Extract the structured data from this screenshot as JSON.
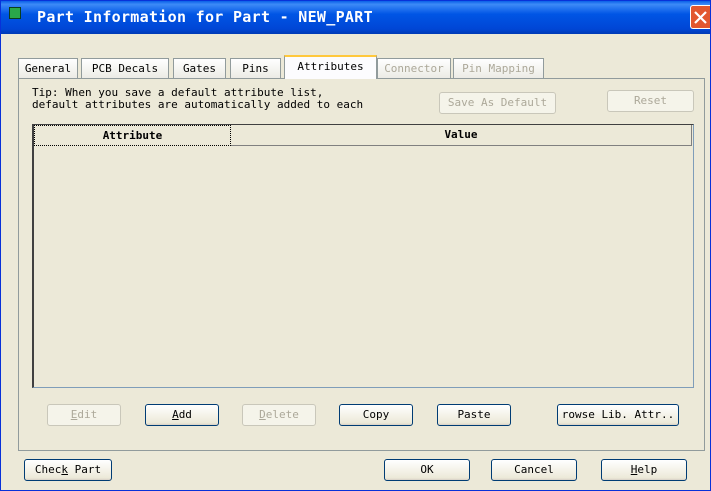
{
  "window": {
    "title": "Part Information for Part - NEW_PART"
  },
  "tabs": [
    {
      "label": "General",
      "state": "normal"
    },
    {
      "label": "PCB Decals",
      "state": "normal"
    },
    {
      "label": "Gates",
      "state": "normal"
    },
    {
      "label": "Pins",
      "state": "normal"
    },
    {
      "label": "Attributes",
      "state": "active"
    },
    {
      "label": "Connector",
      "state": "disabled"
    },
    {
      "label": "Pin Mapping",
      "state": "disabled"
    }
  ],
  "tip": {
    "line1": "Tip: When you save a default attribute list,",
    "line2": "default attributes are automatically added to each"
  },
  "buttons": {
    "save_as_default": "Save As Default",
    "reset": "Reset",
    "edit": "Edit",
    "add": "Add",
    "delete": "Delete",
    "copy": "Copy",
    "paste": "Paste",
    "browse_lib_attr": "rowse Lib. Attr..",
    "check_part": "Check Part",
    "ok": "OK",
    "cancel": "Cancel",
    "help": "Help"
  },
  "table": {
    "columns": [
      "Attribute",
      "Value"
    ],
    "rows": []
  },
  "icons": {
    "app": "app-icon",
    "close": "close-icon"
  },
  "colors": {
    "titlebar": "#0055e5",
    "close": "#e2572f",
    "face": "#ece9d8",
    "active_tab_highlight": "#ffc83c"
  }
}
